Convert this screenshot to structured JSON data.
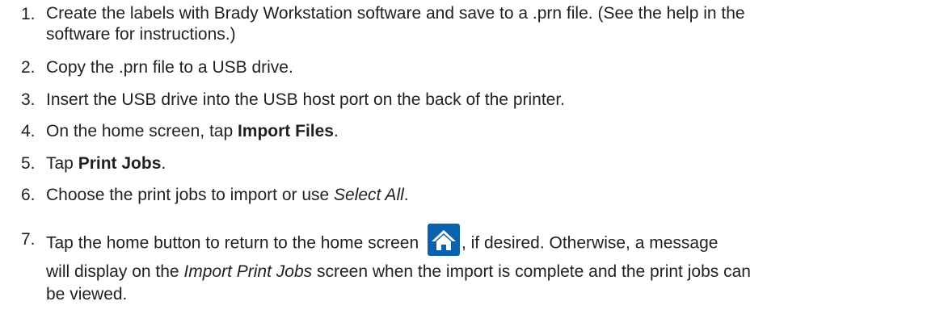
{
  "steps": [
    {
      "number": "1.",
      "text_line1": "Create the labels with Brady Workstation software and save to a .prn file. (See the help in the",
      "text_line2": "software for instructions.)"
    },
    {
      "number": "2.",
      "text": "Copy the .prn file to a USB drive."
    },
    {
      "number": "3.",
      "text": "Insert the USB drive into the USB host port on the back of the printer."
    },
    {
      "number": "4.",
      "text_before": "On the home screen, tap ",
      "bold": "Import Files",
      "text_after": "."
    },
    {
      "number": "5.",
      "text_before": "Tap ",
      "bold": "Print Jobs",
      "text_after": "."
    },
    {
      "number": "6.",
      "text_before": "Choose the print jobs to import or use ",
      "italic": "Select All",
      "text_after": "."
    },
    {
      "number": "7.",
      "text_line1_before": "Tap the home button to return to the home screen",
      "icon": "home-icon",
      "text_line1_after": ", if desired. Otherwise, a message",
      "text_line2_before": "will display on the ",
      "italic": "Import Print Jobs",
      "text_line2_after": " screen when the import is complete and the print jobs can",
      "text_line3": "be viewed."
    }
  ],
  "colors": {
    "text": "#231f20",
    "icon_bg": "#0a61ad",
    "icon_fg": "#ffffff"
  }
}
